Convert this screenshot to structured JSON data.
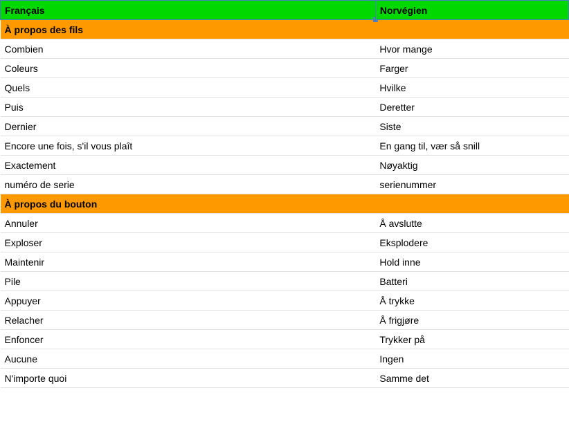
{
  "headers": {
    "left": "Français",
    "right": "Norvégien"
  },
  "sections": [
    {
      "title": "À propos des fils",
      "rows": [
        {
          "left": "Combien",
          "right": "Hvor mange"
        },
        {
          "left": "Coleurs",
          "right": "Farger"
        },
        {
          "left": "Quels",
          "right": "Hvilke"
        },
        {
          "left": "Puis",
          "right": "Deretter"
        },
        {
          "left": "Dernier",
          "right": "Siste"
        },
        {
          "left": "Encore une fois, s'il vous plaît",
          "right": "En gang til, vær så snill"
        },
        {
          "left": "Exactement",
          "right": "Nøyaktig"
        },
        {
          "left": "numéro de serie",
          "right": "serienummer"
        }
      ]
    },
    {
      "title": "À propos du bouton",
      "rows": [
        {
          "left": "Annuler",
          "right": "Å avslutte"
        },
        {
          "left": "Exploser",
          "right": "Eksplodere"
        },
        {
          "left": "Maintenir",
          "right": "Hold inne"
        },
        {
          "left": "Pile",
          "right": "Batteri"
        },
        {
          "left": "Appuyer",
          "right": "Å trykke"
        },
        {
          "left": "Relacher",
          "right": "Å frigjøre"
        },
        {
          "left": "Enfoncer",
          "right": "Trykker på"
        },
        {
          "left": "Aucune",
          "right": "Ingen"
        },
        {
          "left": "N'importe quoi",
          "right": "Samme det"
        }
      ]
    }
  ]
}
